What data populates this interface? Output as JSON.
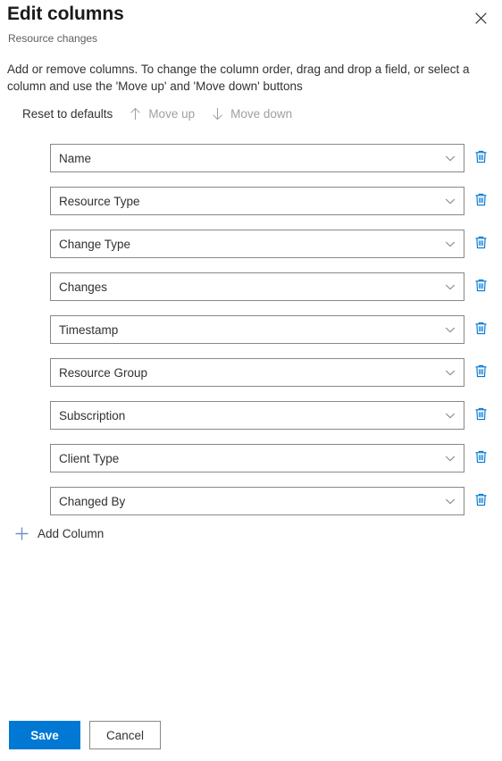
{
  "header": {
    "title": "Edit columns",
    "subtitle": "Resource changes",
    "close_icon": "close-icon"
  },
  "description": "Add or remove columns. To change the column order, drag and drop a field, or select a column and use the 'Move up' and 'Move down' buttons",
  "commandbar": {
    "reset": {
      "label": "Reset to defaults",
      "disabled": false
    },
    "move_up": {
      "label": "Move up",
      "icon": "arrow-up-icon",
      "disabled": true
    },
    "move_down": {
      "label": "Move down",
      "icon": "arrow-down-icon",
      "disabled": true
    }
  },
  "columns": [
    {
      "label": "Name",
      "delete_icon": "trash-icon",
      "chevron_icon": "chevron-down-icon"
    },
    {
      "label": "Resource Type",
      "delete_icon": "trash-icon",
      "chevron_icon": "chevron-down-icon"
    },
    {
      "label": "Change Type",
      "delete_icon": "trash-icon",
      "chevron_icon": "chevron-down-icon"
    },
    {
      "label": "Changes",
      "delete_icon": "trash-icon",
      "chevron_icon": "chevron-down-icon"
    },
    {
      "label": "Timestamp",
      "delete_icon": "trash-icon",
      "chevron_icon": "chevron-down-icon"
    },
    {
      "label": "Resource Group",
      "delete_icon": "trash-icon",
      "chevron_icon": "chevron-down-icon"
    },
    {
      "label": "Subscription",
      "delete_icon": "trash-icon",
      "chevron_icon": "chevron-down-icon"
    },
    {
      "label": "Client Type",
      "delete_icon": "trash-icon",
      "chevron_icon": "chevron-down-icon"
    },
    {
      "label": "Changed By",
      "delete_icon": "trash-icon",
      "chevron_icon": "chevron-down-icon"
    }
  ],
  "add_column": {
    "label": "Add Column",
    "icon": "plus-icon"
  },
  "footer": {
    "save_label": "Save",
    "cancel_label": "Cancel"
  },
  "colors": {
    "accent": "#0078d4",
    "text": "#323130",
    "text_secondary": "#605e5c",
    "disabled": "#a19f9d",
    "border": "#8a8886"
  }
}
